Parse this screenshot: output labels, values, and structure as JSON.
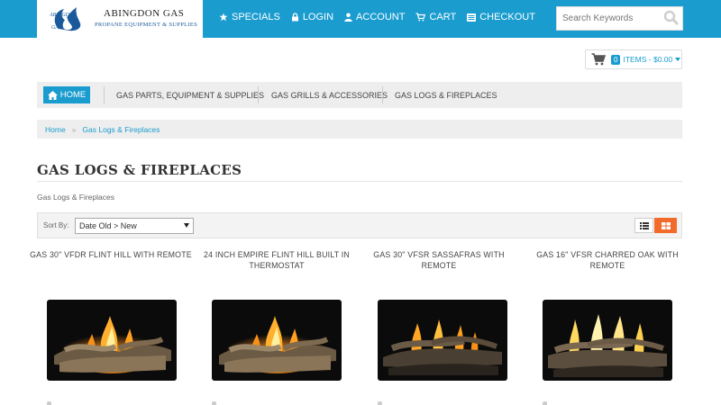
{
  "brand": {
    "name": "ABINGDON GAS",
    "tagline": "PROPANE EQUIPMENT & SUPPLIES",
    "emblem_text": "ABINGDON GAS",
    "color": "#1a9ccf"
  },
  "topnav": [
    {
      "label": "SPECIALS",
      "icon": "star-icon"
    },
    {
      "label": "LOGIN",
      "icon": "lock-icon"
    },
    {
      "label": "ACCOUNT",
      "icon": "user-icon"
    },
    {
      "label": "CART",
      "icon": "cart-icon"
    },
    {
      "label": "CHECKOUT",
      "icon": "list-icon"
    }
  ],
  "search": {
    "placeholder": "Search Keywords",
    "icon": "search-icon"
  },
  "cart": {
    "count": "0",
    "summary": "ITEMS - $0.00",
    "icon": "shopping-cart-icon"
  },
  "mainnav": {
    "home": "HOME",
    "items": [
      "GAS PARTS, EQUIPMENT & SUPPLIES",
      "GAS GRILLS & ACCESSORIES",
      "GAS LOGS & FIREPLACES"
    ]
  },
  "breadcrumb": {
    "home": "Home",
    "separator": "»",
    "current": "Gas Logs & Fireplaces"
  },
  "page": {
    "title": "GAS LOGS & FIREPLACES",
    "subtitle": "Gas Logs & Fireplaces"
  },
  "sort": {
    "label": "Sort By:",
    "selected": "Date Old > New"
  },
  "colors": {
    "accent": "#1a9ccf",
    "grid_active": "#f26b2a",
    "bar_bg": "#eeeeee"
  },
  "products": [
    {
      "title": "GAS 30\" VFDR FLINT HILL WITH REMOTE"
    },
    {
      "title": "24 INCH EMPIRE FLINT HILL BUILT IN THERMOSTAT"
    },
    {
      "title": "GAS 30\" VFSR SASSAFRAS WITH REMOTE"
    },
    {
      "title": "GAS 16\" VFSR CHARRED OAK WITH REMOTE"
    }
  ]
}
